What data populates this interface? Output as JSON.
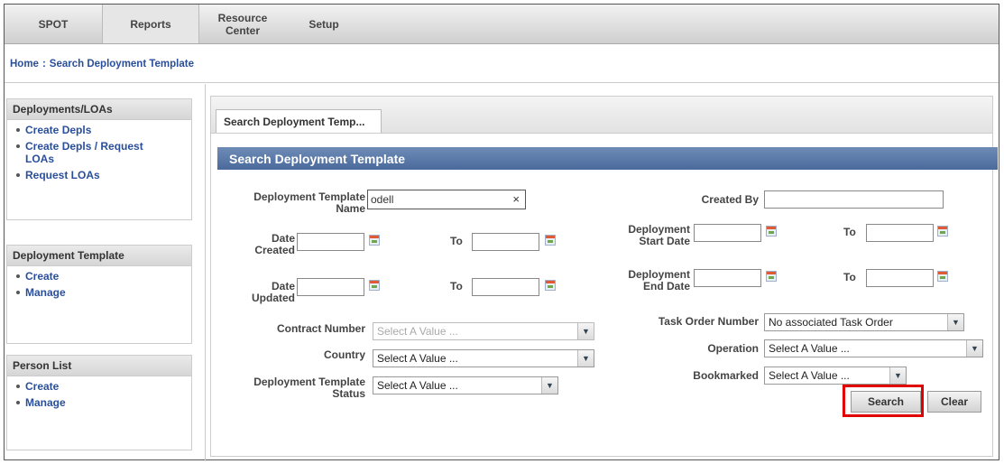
{
  "nav": {
    "tabs": [
      {
        "label": "SPOT"
      },
      {
        "label": "Reports"
      },
      {
        "label": "Resource\nCenter"
      },
      {
        "label": "Setup"
      }
    ]
  },
  "breadcrumb": {
    "home": "Home",
    "sep": ":",
    "current": "Search Deployment Template"
  },
  "sidebar": {
    "sections": [
      {
        "title": "Deployments/LOAs",
        "items": [
          "Create Depls",
          "Create Depls / Request LOAs",
          "Request LOAs"
        ]
      },
      {
        "title": "Deployment Template",
        "items": [
          "Create",
          "Manage"
        ]
      },
      {
        "title": "Person List",
        "items": [
          "Create",
          "Manage"
        ]
      }
    ]
  },
  "main": {
    "tab_label": "Search Deployment Temp...",
    "form_title": "Search Deployment Template",
    "fields": {
      "template_name_label": "Deployment Template Name",
      "template_name_value": "odell",
      "clear_x": "×",
      "created_by_label": "Created By",
      "date_created_label": "Date Created",
      "date_updated_label": "Date Updated",
      "to_label": "To",
      "start_date_label": "Deployment Start Date",
      "end_date_label": "Deployment End Date",
      "contract_number_label": "Contract Number",
      "contract_number_value": "Select A Value ...",
      "country_label": "Country",
      "country_value": "Select A Value ...",
      "status_label": "Deployment Template Status",
      "status_value": "Select A Value ...",
      "task_order_label": "Task Order Number",
      "task_order_value": "No associated Task Order",
      "operation_label": "Operation",
      "operation_value": "Select A Value ...",
      "bookmarked_label": "Bookmarked",
      "bookmarked_value": "Select A Value ..."
    },
    "buttons": {
      "search": "Search",
      "clear": "Clear"
    }
  },
  "colors": {
    "highlight": "#e00000",
    "header_blue": "#4a6a9c",
    "link_blue": "#2a4f9a"
  }
}
